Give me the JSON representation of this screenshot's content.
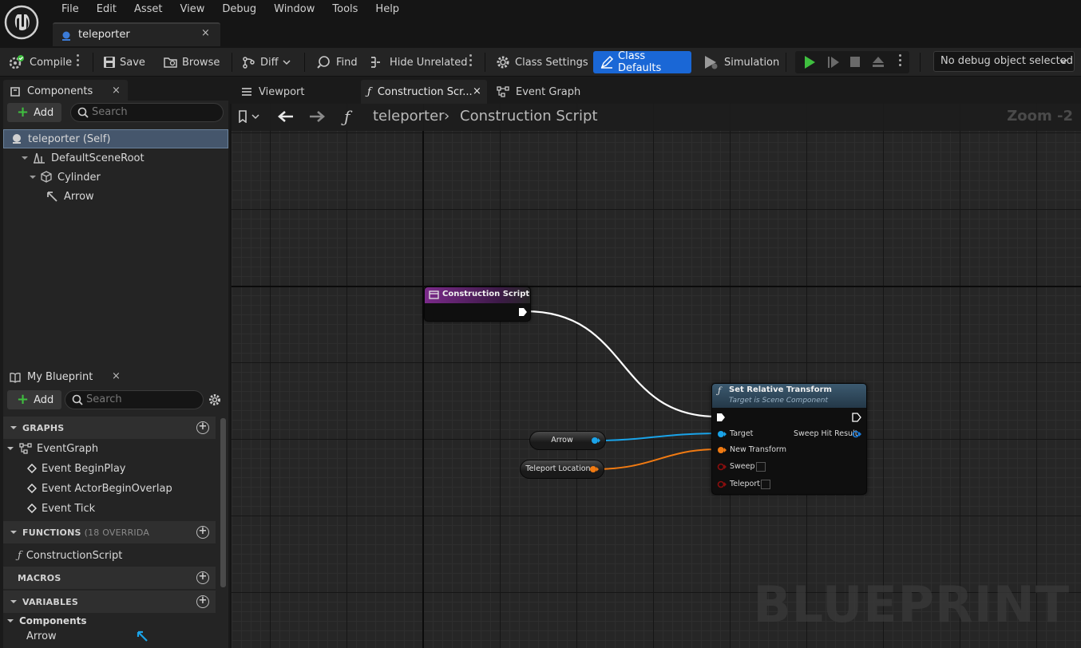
{
  "menu": [
    "File",
    "Edit",
    "Asset",
    "View",
    "Debug",
    "Window",
    "Tools",
    "Help"
  ],
  "asset_tab": {
    "label": "teleporter",
    "close": "×"
  },
  "toolbar": {
    "compile": "Compile",
    "save": "Save",
    "browse": "Browse",
    "diff": "Diff",
    "find": "Find",
    "hide_unrelated": "Hide Unrelated",
    "class_settings": "Class Settings",
    "class_defaults": "Class Defaults",
    "simulation": "Simulation",
    "debug_object": "No debug object selected",
    "accent": "#1a67d6",
    "play_color": "#3fbf3f"
  },
  "components": {
    "tab_label": "Components",
    "close": "×",
    "add_label": "Add",
    "search_placeholder": "Search",
    "items": [
      "teleporter (Self)",
      "DefaultSceneRoot",
      "Cylinder",
      "Arrow"
    ]
  },
  "my_blueprint": {
    "tab_label": "My Blueprint",
    "close": "×",
    "add_label": "Add",
    "search_placeholder": "Search",
    "graphs_header": "GRAPHS",
    "graphs": [
      "EventGraph",
      "Event BeginPlay",
      "Event ActorBeginOverlap",
      "Event Tick"
    ],
    "functions_header": "FUNCTIONS",
    "functions_override": "(18 OVERRIDA",
    "functions": [
      "ConstructionScript"
    ],
    "macros_header": "MACROS",
    "variables_header": "VARIABLES",
    "components_group": "Components",
    "variables": [
      "Arrow"
    ]
  },
  "graph_tabs": {
    "viewport": "Viewport",
    "construction": "Construction Scr...",
    "event_graph": "Event Graph",
    "close": "×"
  },
  "graph": {
    "breadcrumb_root": "teleporter",
    "breadcrumb_sep": "›",
    "breadcrumb_leaf": "Construction Script",
    "zoom": "Zoom -2",
    "watermark": "BLUEPRINT"
  },
  "nodes": {
    "construction_script": {
      "title": "Construction Script"
    },
    "set_relative_transform": {
      "title": "Set Relative Transform",
      "subtitle": "Target is Scene Component",
      "pins": {
        "target": "Target",
        "new_transform": "New Transform",
        "sweep": "Sweep",
        "teleport": "Teleport",
        "sweep_hit": "Sweep Hit Result"
      }
    },
    "arrow_var": "Arrow",
    "teleport_location_var": "Teleport Location",
    "colors": {
      "object_pin": "#1aa3e8",
      "transform_pin": "#f07a12",
      "bool_pin": "#8a0e0e",
      "exec_wire": "#ffffff"
    }
  }
}
